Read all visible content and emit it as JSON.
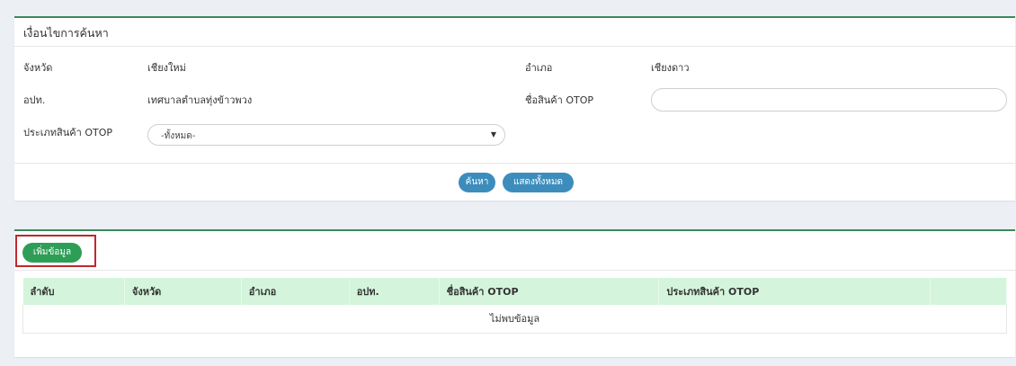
{
  "search": {
    "header": "เงื่อนไขการค้นหา",
    "province_label": "จังหวัด",
    "province_value": "เชียงใหม่",
    "district_label": "อำเภอ",
    "district_value": "เชียงดาว",
    "lao_label": "อปท.",
    "lao_value": "เทศบาลตำบลทุ่งข้าวพวง",
    "product_name_label": "ชื่อสินค้า OTOP",
    "product_name_value": "",
    "product_type_label": "ประเภทสินค้า OTOP",
    "product_type_selected": "-ทั้งหมด-",
    "search_button": "ค้นหา",
    "show_all_button": "แสดงทั้งหมด"
  },
  "results": {
    "add_button": "เพิ่มข้อมูล",
    "columns": [
      "ลำดับ",
      "จังหวัด",
      "อำเภอ",
      "อปท.",
      "ชื่อสินค้า OTOP",
      "ประเภทสินค้า OTOP",
      ""
    ],
    "empty_message": "ไม่พบข้อมูล"
  },
  "colors": {
    "accent_green": "#2e9e57",
    "button_blue": "#3c8dbc",
    "table_header": "#d4f5db",
    "highlight_red": "#c0272d"
  },
  "icons": {
    "select_caret": "caret-down-icon"
  }
}
